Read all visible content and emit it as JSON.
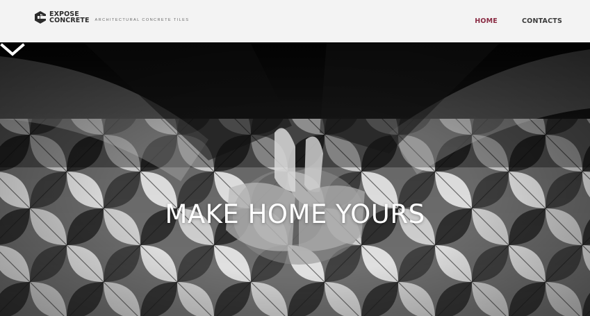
{
  "header": {
    "logo_line1": "EXPOSE",
    "logo_line2": "CONCRETE",
    "tagline": "ARCHITECTURAL CONCRETE TILES",
    "nav": [
      {
        "label": "HOME",
        "active": true
      },
      {
        "label": "CONTACTS",
        "active": false
      }
    ]
  },
  "hero": {
    "headline": "MAKE HOME YOURS",
    "scroll_icon": "chevron-down-icon"
  },
  "colors": {
    "accent": "#8a2b43",
    "nav_text": "#3a3a3a",
    "header_bg": "#f3f3f3"
  }
}
